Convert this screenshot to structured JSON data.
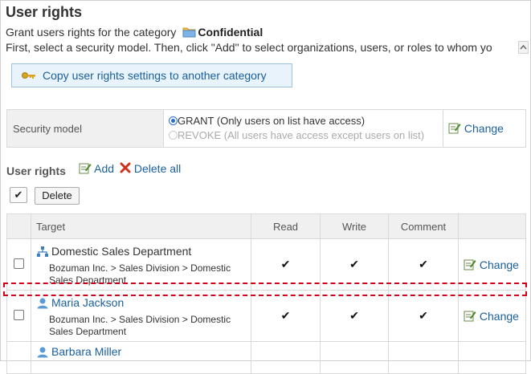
{
  "page": {
    "title": "User rights",
    "desc_prefix": "Grant users rights for the category",
    "category_name": "Confidential",
    "desc_line2": "First, select a security model. Then, click \"Add\" to select organizations, users, or roles to whom yo"
  },
  "copy_button": {
    "label": "Copy user rights settings to another category"
  },
  "security": {
    "label": "Security model",
    "grant_label": "GRANT (Only users on list have access)",
    "revoke_label": "REVOKE (All users have access except users on list)",
    "change_label": "Change"
  },
  "user_rights": {
    "heading": "User rights",
    "add_label": "Add",
    "delete_all_label": "Delete all",
    "select_all_mark": "✔",
    "delete_button": "Delete"
  },
  "table": {
    "headers": {
      "target": "Target",
      "read": "Read",
      "write": "Write",
      "comment": "Comment"
    },
    "rows": [
      {
        "name": "Domestic Sales Department",
        "type": "organization",
        "path": "Bozuman Inc. > Sales Division > Domestic Sales Department",
        "read": "✔",
        "write": "✔",
        "comment": "✔",
        "change": "Change"
      },
      {
        "name": "Maria Jackson",
        "type": "user",
        "path": "Bozuman Inc. > Sales Division > Domestic Sales Department",
        "read": "✔",
        "write": "✔",
        "comment": "✔",
        "change": "Change"
      },
      {
        "name": "Barbara Miller",
        "type": "user"
      }
    ]
  },
  "colors": {
    "link": "#1a5f9c",
    "highlight_border": "#d0021b",
    "header_bg": "#f0f0f0"
  }
}
